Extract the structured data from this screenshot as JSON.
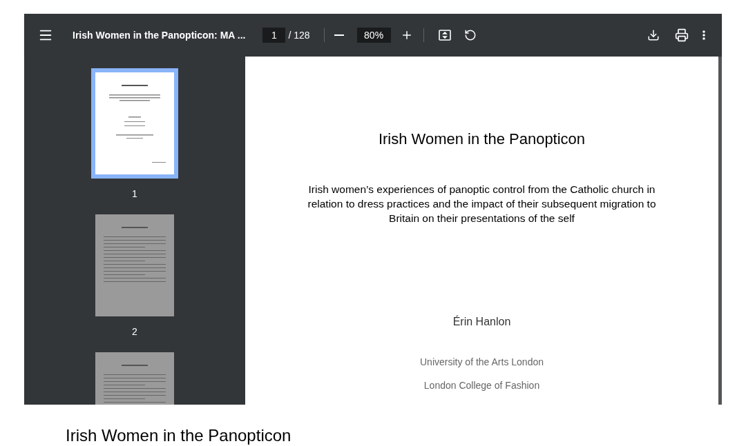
{
  "toolbar": {
    "title": "Irish Women in the Panopticon: MA ...",
    "page_number": "1",
    "page_count": "/ 128",
    "zoom": "80%"
  },
  "thumbnails": [
    {
      "label": "1",
      "selected": true
    },
    {
      "label": "2",
      "selected": false
    },
    {
      "selected": false
    }
  ],
  "page": {
    "title": "Irish Women in the Panopticon",
    "subtitle": "Irish women’s experiences of panoptic control from the Catholic church in relation to dress practices and the impact of their subsequent migration to Britain on their presentations of the self",
    "author": "Érin Hanlon",
    "institutions": [
      "University of the Arts London",
      "London College of Fashion"
    ]
  },
  "caption": "Irish Women in the Panopticon"
}
